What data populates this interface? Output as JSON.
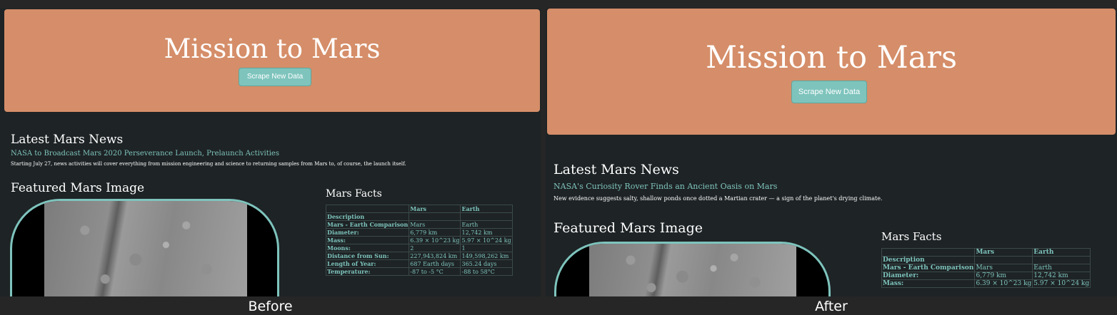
{
  "captions": {
    "before": "Before",
    "after": "After"
  },
  "before": {
    "title": "Mission to Mars",
    "button": "Scrape New Data",
    "news_heading": "Latest Mars News",
    "news_title": "NASA to Broadcast Mars 2020 Perseverance Launch, Prelaunch Activities",
    "news_teaser": "Starting July 27, news activities will cover everything from mission engineering and science to returning samples from Mars to, of course, the launch itself.",
    "image_heading": "Featured Mars Image",
    "facts_heading": "Mars Facts",
    "facts": {
      "columns": [
        "",
        "Mars",
        "Earth"
      ],
      "rows": [
        [
          "Description",
          "",
          ""
        ],
        [
          "Mars - Earth Comparison",
          "Mars",
          "Earth"
        ],
        [
          "Diameter:",
          "6,779 km",
          "12,742 km"
        ],
        [
          "Mass:",
          "6.39 × 10^23 kg",
          "5.97 × 10^24 kg"
        ],
        [
          "Moons:",
          "2",
          "1"
        ],
        [
          "Distance from Sun:",
          "227,943,824 km",
          "149,598,262 km"
        ],
        [
          "Length of Year:",
          "687 Earth days",
          "365.24 days"
        ],
        [
          "Temperature:",
          "-87 to -5 °C",
          "-88 to 58°C"
        ]
      ]
    }
  },
  "after": {
    "title": "Mission to Mars",
    "button": "Scrape New Data",
    "news_heading": "Latest Mars News",
    "news_title": "NASA's Curiosity Rover Finds an Ancient Oasis on Mars",
    "news_teaser": "New evidence suggests salty, shallow ponds once dotted a Martian crater — a sign of the planet's drying climate.",
    "image_heading": "Featured Mars Image",
    "facts_heading": "Mars Facts",
    "facts": {
      "columns": [
        "",
        "Mars",
        "Earth"
      ],
      "rows": [
        [
          "Description",
          "",
          ""
        ],
        [
          "Mars - Earth Comparison",
          "Mars",
          "Earth"
        ],
        [
          "Diameter:",
          "6,779 km",
          "12,742 km"
        ],
        [
          "Mass:",
          "6.39 × 10^23 kg",
          "5.97 × 10^24 kg"
        ]
      ]
    }
  }
}
